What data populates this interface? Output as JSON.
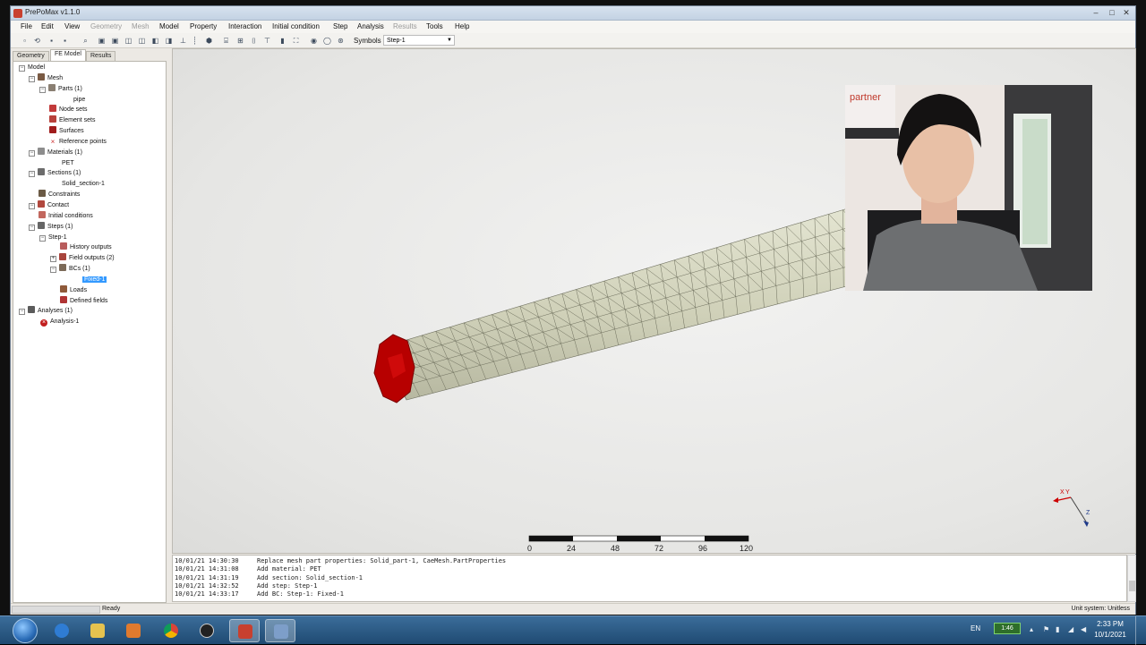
{
  "window": {
    "title": "PrePoMax v1.1.0"
  },
  "menu": [
    {
      "label": "File",
      "enabled": true
    },
    {
      "label": "Edit",
      "enabled": true
    },
    {
      "label": "View",
      "enabled": true
    },
    {
      "label": "Geometry",
      "enabled": false
    },
    {
      "label": "Mesh",
      "enabled": false
    },
    {
      "label": "Model",
      "enabled": true
    },
    {
      "label": "Property",
      "enabled": true
    },
    {
      "label": "Interaction",
      "enabled": true
    },
    {
      "label": "Initial condition",
      "enabled": true
    },
    {
      "label": "Step",
      "enabled": true
    },
    {
      "label": "Analysis",
      "enabled": true
    },
    {
      "label": "Results",
      "enabled": false
    },
    {
      "label": "Tools",
      "enabled": true
    },
    {
      "label": "Help",
      "enabled": true
    }
  ],
  "toolbar": {
    "symbols_label": "Symbols",
    "step_selected": "Step-1"
  },
  "tabs": [
    "Geometry",
    "FE Model",
    "Results"
  ],
  "active_tab": "FE Model",
  "tree": {
    "model": "Model",
    "mesh": "Mesh",
    "parts": "Parts (1)",
    "pipe": "pipe",
    "node_sets": "Node sets",
    "element_sets": "Element sets",
    "surfaces": "Surfaces",
    "reference_points": "Reference points",
    "materials": "Materials (1)",
    "pet": "PET",
    "sections": "Sections (1)",
    "solid_section": "Solid_section-1",
    "constraints": "Constraints",
    "contact": "Contact",
    "initial_conditions": "Initial conditions",
    "steps": "Steps (1)",
    "step1": "Step-1",
    "history_outputs": "History outputs",
    "field_outputs": "Field outputs (2)",
    "bcs": "BCs (1)",
    "fixed1": "Fixed-1",
    "loads": "Loads",
    "defined_fields": "Defined fields",
    "analyses": "Analyses (1)",
    "analysis1": "Analysis-1"
  },
  "scale_bar": {
    "ticks": [
      "0",
      "24",
      "48",
      "72",
      "96",
      "120"
    ]
  },
  "axis_triad": {
    "x_label": "X",
    "y_label": "Y",
    "z_label": "Z"
  },
  "webcam": {
    "sign_text": "partner"
  },
  "console": [
    {
      "time": "10/01/21 14:30:30",
      "msg": "Replace mesh part properties: Solid_part-1, CaeMesh.PartProperties"
    },
    {
      "time": "10/01/21 14:31:08",
      "msg": "Add material: PET"
    },
    {
      "time": "10/01/21 14:31:19",
      "msg": "Add section: Solid_section-1"
    },
    {
      "time": "10/01/21 14:32:52",
      "msg": "Add step: Step-1"
    },
    {
      "time": "10/01/21 14:33:17",
      "msg": "Add BC: Step-1: Fixed-1"
    }
  ],
  "status": {
    "text": "Ready",
    "unit_system": "Unit system: Unitless"
  },
  "taskbar": {
    "lang": "EN",
    "battery": "1:46",
    "time": "2:33 PM",
    "date": "10/1/2021"
  },
  "colors": {
    "mesh_fill": "#d6d7c1",
    "fixed_bc": "#b70000",
    "selection": "#3399ff"
  }
}
